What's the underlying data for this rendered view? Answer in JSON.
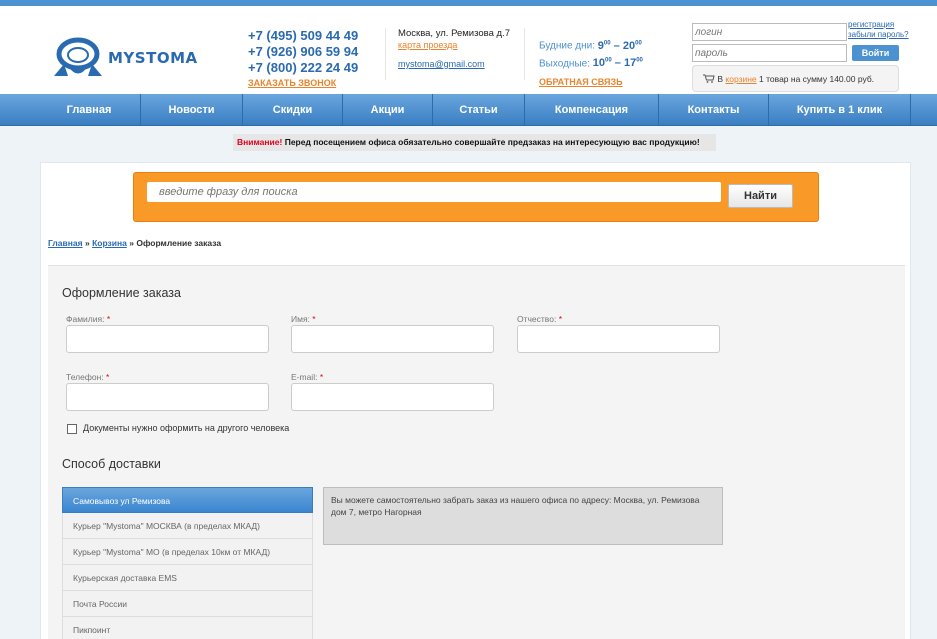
{
  "header": {
    "logo_text": "MYSTOMA",
    "phones": [
      "+7 (495) 509 44 49",
      "+7 (926) 906 59 94",
      "+7 (800) 222 24 49"
    ],
    "call_link": "ЗАКАЗАТЬ ЗВОНОК",
    "address": "Москва, ул. Ремизова д.7",
    "map_link": "карта проезда",
    "email": "mystoma@gmail.com",
    "weekdays_label": "Будние дни:",
    "weekdays_open": "9",
    "weekdays_close": "20",
    "weekend_label": "Выходные:",
    "weekend_open": "10",
    "weekend_close": "17",
    "minutes": "00",
    "hours_dash": "–",
    "feedback_link": "ОБРАТНАЯ СВЯЗЬ",
    "login_placeholder": "логин",
    "password_placeholder": "пароль",
    "register_link": "регистрация",
    "forgot_link": "забыли пароль?",
    "login_button": "Войти",
    "cart_prefix": "В",
    "cart_link": "корзине",
    "cart_summary": "1 товар на сумму 140.00 руб."
  },
  "nav": {
    "items": [
      "Главная",
      "Новости",
      "Скидки",
      "Акции",
      "Статьи",
      "Компенсация",
      "Контакты",
      "Купить в 1 клик"
    ]
  },
  "notice": {
    "warning": "Внимание!",
    "text": "Перед посещением офиса обязательно совершайте предзаказ на интересующую вас продукцию!"
  },
  "search": {
    "placeholder": "введите фразу для поиска",
    "button": "Найти"
  },
  "breadcrumb": {
    "home": "Главная",
    "sep": "»",
    "cart": "Корзина",
    "current": "Оформление заказа"
  },
  "order": {
    "title": "Оформление заказа",
    "required_mark": "*",
    "fields": {
      "lastname": "Фамилия:",
      "firstname": "Имя:",
      "patronymic": "Отчество:",
      "phone": "Телефон:",
      "email": "E-mail:"
    },
    "other_person": "Документы нужно оформить на другого человека",
    "delivery_title": "Способ доставки",
    "delivery_options": [
      "Самовывоз ул Ремизова",
      "Курьер \"Mystoma\" МОСКВА (в пределах МКАД)",
      "Курьер \"Mystoma\" МО (в пределах 10км от МКАД)",
      "Курьерская доставка EMS",
      "Почта России",
      "Пикпоинт"
    ],
    "selected_index": 0,
    "delivery_desc": "Вы можете самостоятельно забрать заказ из нашего офиса по адресу: Москва, ул. Ремизова дом 7, метро Нагорная"
  }
}
